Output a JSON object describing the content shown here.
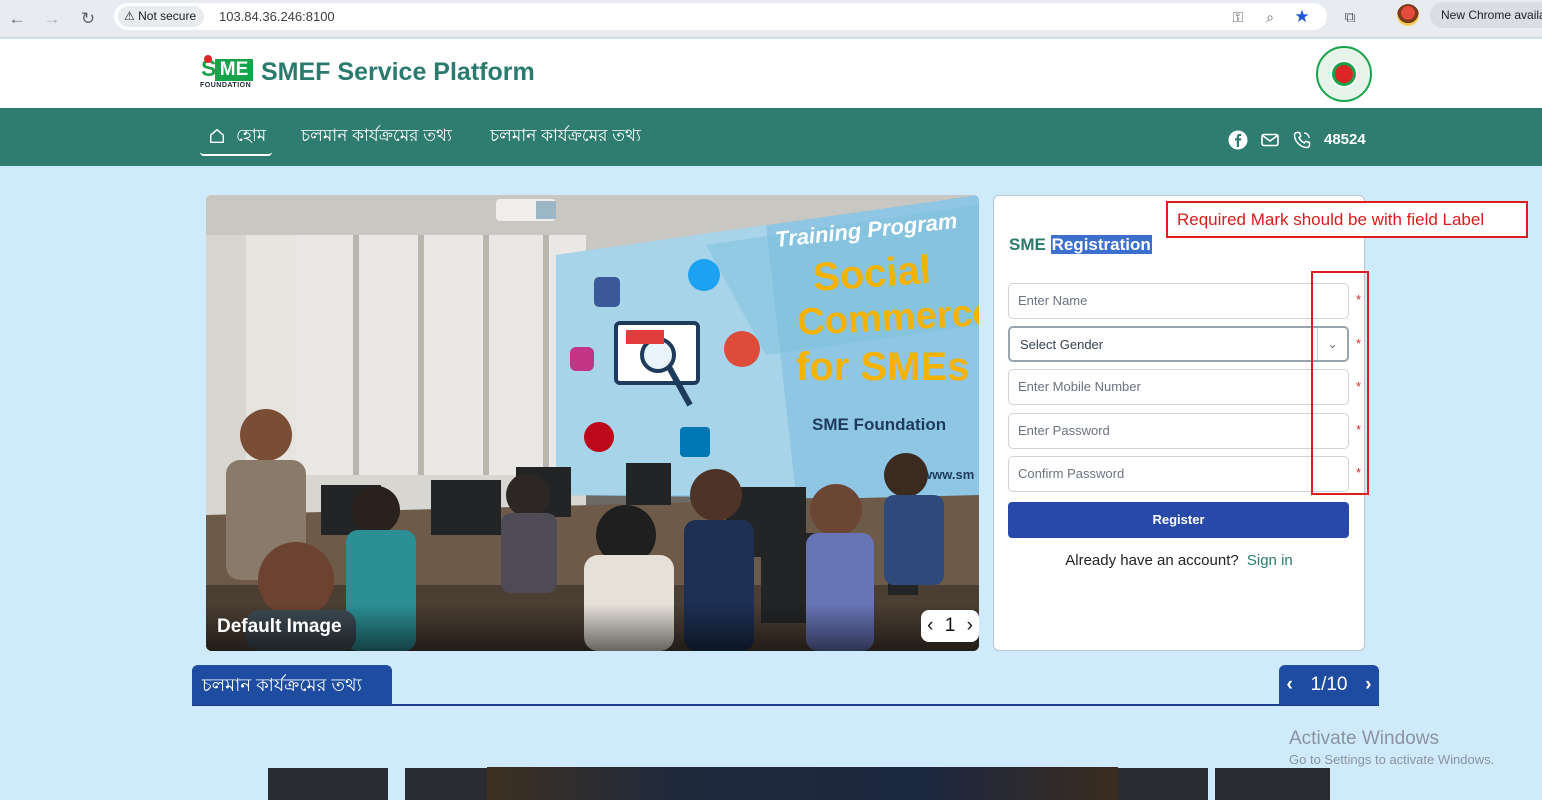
{
  "browser": {
    "security_label": "Not secure",
    "url": "103.84.36.246:8100",
    "new_chrome_label": "New Chrome available",
    "star_color": "#1a56d6"
  },
  "header": {
    "logo": {
      "sme": "SME",
      "foundation": "FOUNDATION"
    },
    "title": "SMEF Service Platform"
  },
  "nav": {
    "home_label": "হোম",
    "links": [
      "চলমান কার্যক্রমের তথ্য",
      "চলমান কার্যক্রমের তথ্য"
    ],
    "phone": "48524",
    "bg_color": "#2e7d70"
  },
  "carousel": {
    "caption": "Default Image",
    "page": "1",
    "banner_texts": {
      "training": "Training Program",
      "social": "Social",
      "commerce": "Commerce",
      "for_smes": "for SMEs",
      "org": "SME Foundation",
      "web": "www.sm"
    }
  },
  "registration": {
    "title_prefix": "SME",
    "title_highlight": "Registration",
    "fields": [
      {
        "placeholder": "Enter Name",
        "required_mark": "*"
      },
      {
        "placeholder": "Select Gender",
        "required_mark": "*"
      },
      {
        "placeholder": "Enter Mobile Number",
        "required_mark": "*"
      },
      {
        "placeholder": "Enter Password",
        "required_mark": "*"
      },
      {
        "placeholder": "Confirm Password",
        "required_mark": "*"
      }
    ],
    "register_label": "Register",
    "already_text": "Already have an account?",
    "signin_label": "Sign in",
    "button_color": "#2849a9"
  },
  "annotation": {
    "text": "Required Mark should be with field Label",
    "color": "#e11d1d"
  },
  "section": {
    "tab_label": "চলমান কার্যক্রমের তথ্য",
    "pager_prev": "‹",
    "pager_count": "1/10",
    "pager_next": "›"
  },
  "windows_watermark": {
    "line1": "Activate Windows",
    "line2": "Go to Settings to activate Windows."
  }
}
